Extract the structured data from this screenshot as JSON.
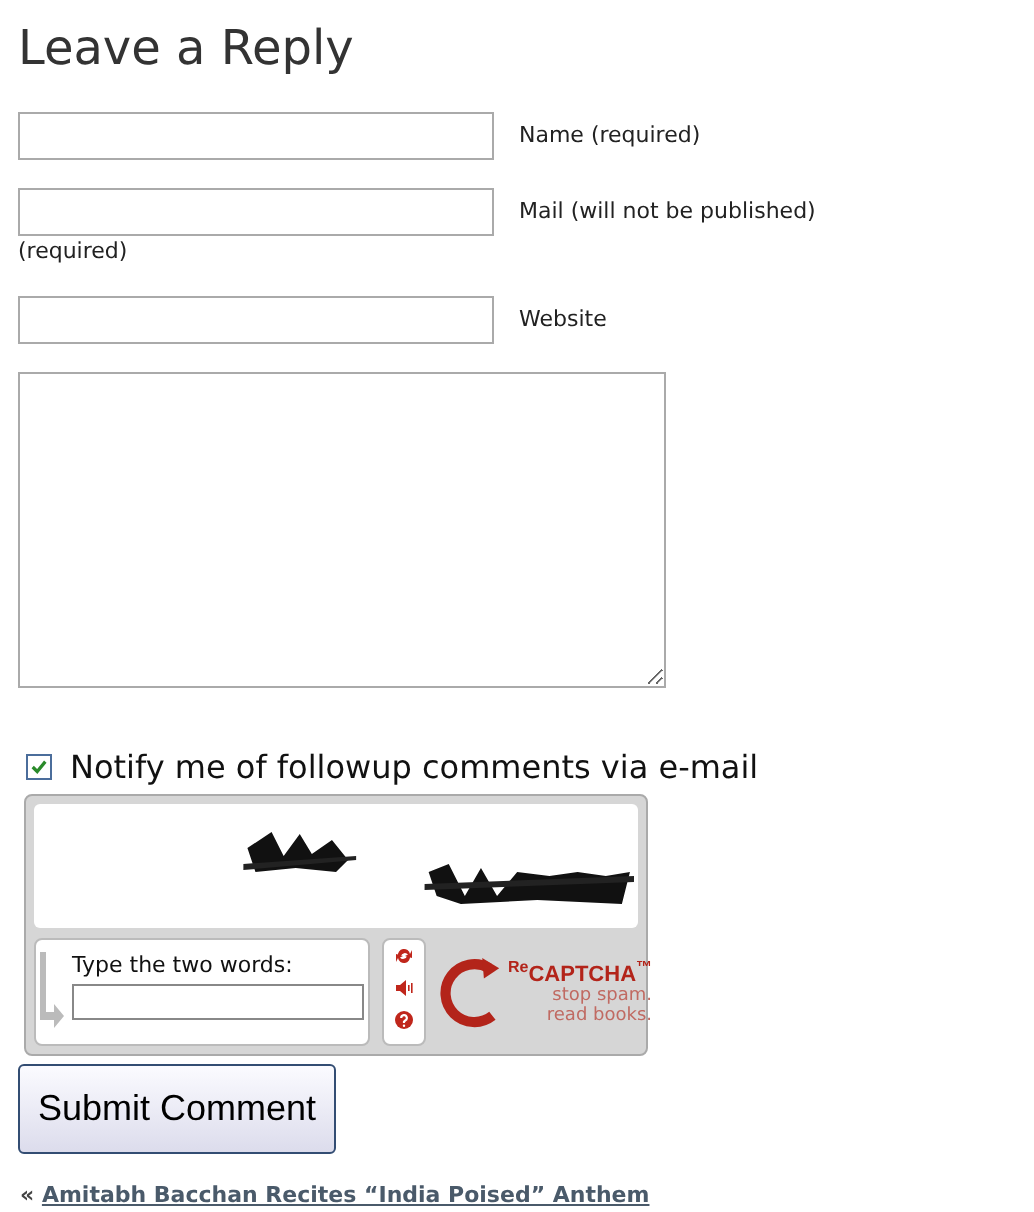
{
  "heading": "Leave a Reply",
  "fields": [
    {
      "label": "Name (required)"
    },
    {
      "label": "Mail (will not be published)",
      "note": "(required)"
    },
    {
      "label": "Website"
    }
  ],
  "notify": {
    "label": "Notify me of followup comments via e-mail",
    "checked": true
  },
  "captcha": {
    "kind": "picture",
    "prompt": "Type the two words:",
    "logo": "$^{Re}$CAPTCHA$^{™}$",
    "tagline": [
      "stop spam.",
      "read books."
    ]
  },
  "submit": "Submit Comment",
  "prev_post": {
    "marker": "«",
    "title": "Amitabh Bacchan Recites “India Poised” Anthem"
  }
}
